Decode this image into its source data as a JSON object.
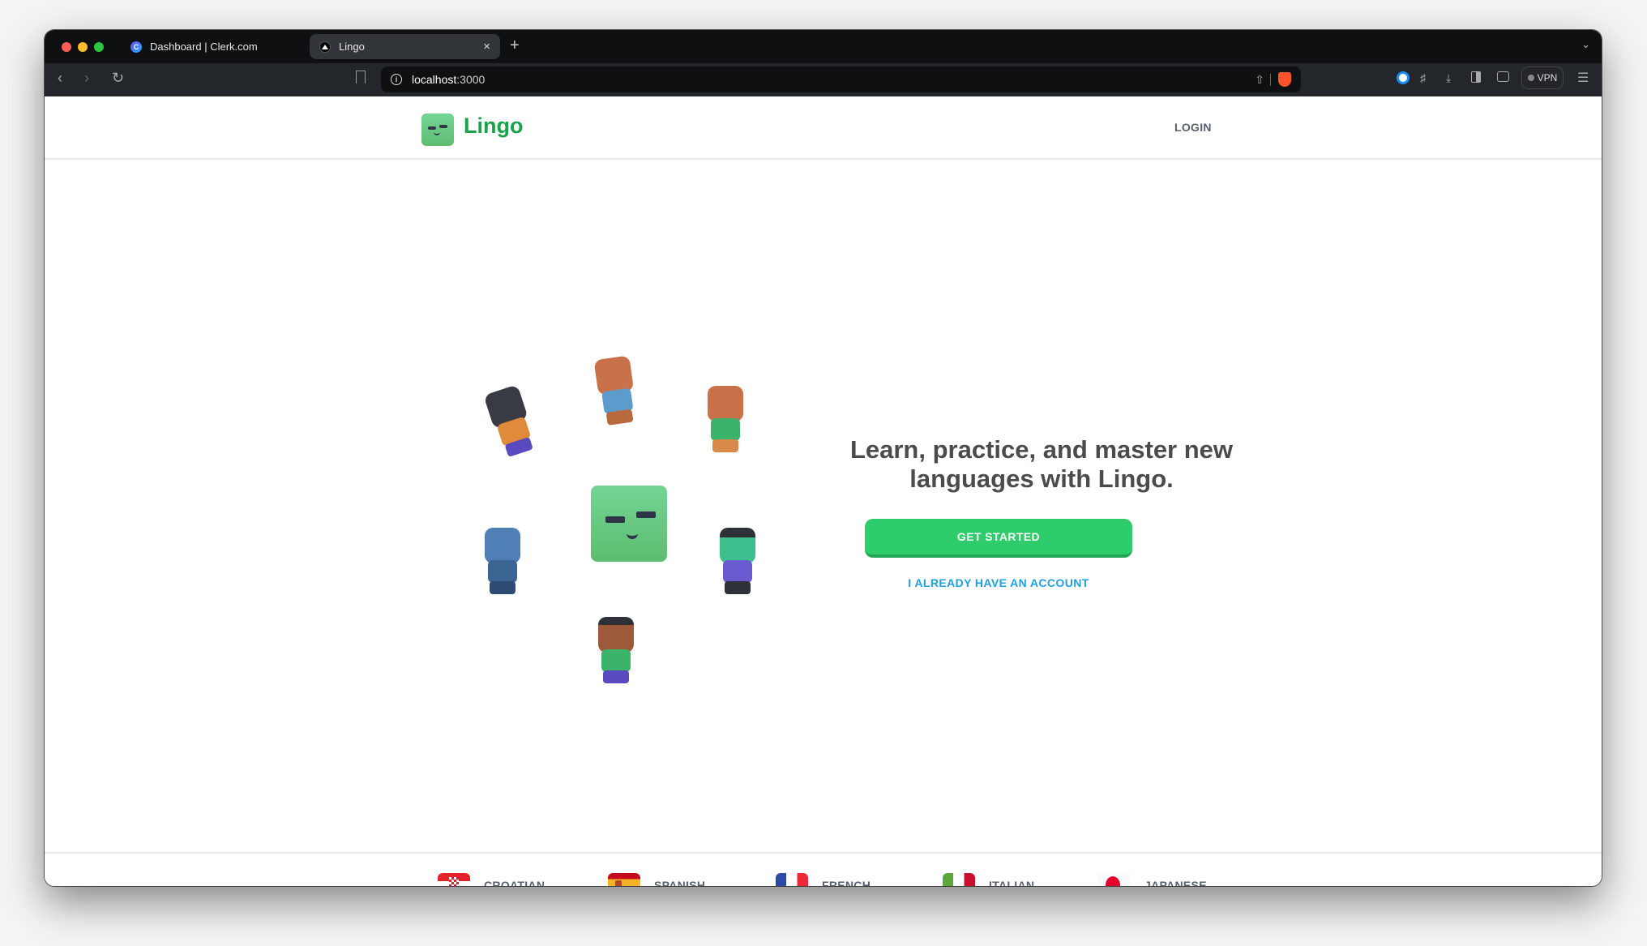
{
  "browser": {
    "tabs": [
      {
        "title": "Dashboard | Clerk.com",
        "active": false,
        "favicon": "clerk-icon"
      },
      {
        "title": "Lingo",
        "active": true,
        "favicon": "vercel-icon"
      }
    ],
    "new_tab_label": "+",
    "close_label": "×",
    "url_host": "localhost",
    "url_port": ":3000",
    "vpn_label": "VPN"
  },
  "header": {
    "logo_text": "Lingo",
    "login_label": "LOGIN"
  },
  "hero": {
    "headline_line1": "Learn, practice, and master new",
    "headline_line2": "languages with Lingo.",
    "get_started_label": "GET STARTED",
    "have_account_label": "I ALREADY HAVE AN ACCOUNT"
  },
  "footer": {
    "languages": [
      {
        "label": "CROATIAN",
        "flag": "croatia-flag"
      },
      {
        "label": "SPANISH",
        "flag": "spain-flag"
      },
      {
        "label": "FRENCH",
        "flag": "france-flag"
      },
      {
        "label": "ITALIAN",
        "flag": "italy-flag"
      },
      {
        "label": "JAPANESE",
        "flag": "japan-flag"
      }
    ]
  },
  "colors": {
    "brand_green": "#16a34a",
    "button_green": "#2ecc6b",
    "link_blue": "#1fa0e0",
    "muted_text": "#57606f",
    "headline": "#4b4b4b"
  }
}
